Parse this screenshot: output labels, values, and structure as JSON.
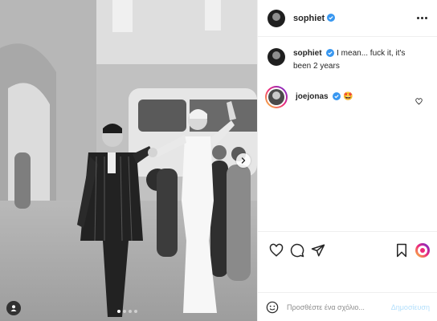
{
  "post": {
    "author": "sophiet",
    "caption": "I mean... fuck it, it's been 2 years",
    "photo_alt": "",
    "carousel_dots": 4,
    "carousel_active_index": 0
  },
  "comments": [
    {
      "author": "joejonas",
      "text": "🤩"
    }
  ],
  "composer": {
    "placeholder": "Προσθέστε ένα σχόλιο...",
    "post_label": "Δημοσίευση"
  },
  "icons": {
    "verified": "verified-badge-icon",
    "more": "more-options-icon",
    "like": "heart-icon",
    "comment": "comment-bubble-icon",
    "share": "paper-plane-icon",
    "save": "bookmark-icon",
    "emoji": "smiley-icon",
    "tag": "person-tag-icon",
    "next": "chevron-right-icon"
  },
  "colors": {
    "verified": "#3897f0",
    "post_button_disabled": "#b2dffc",
    "border": "#efefef",
    "text": "#262626"
  }
}
